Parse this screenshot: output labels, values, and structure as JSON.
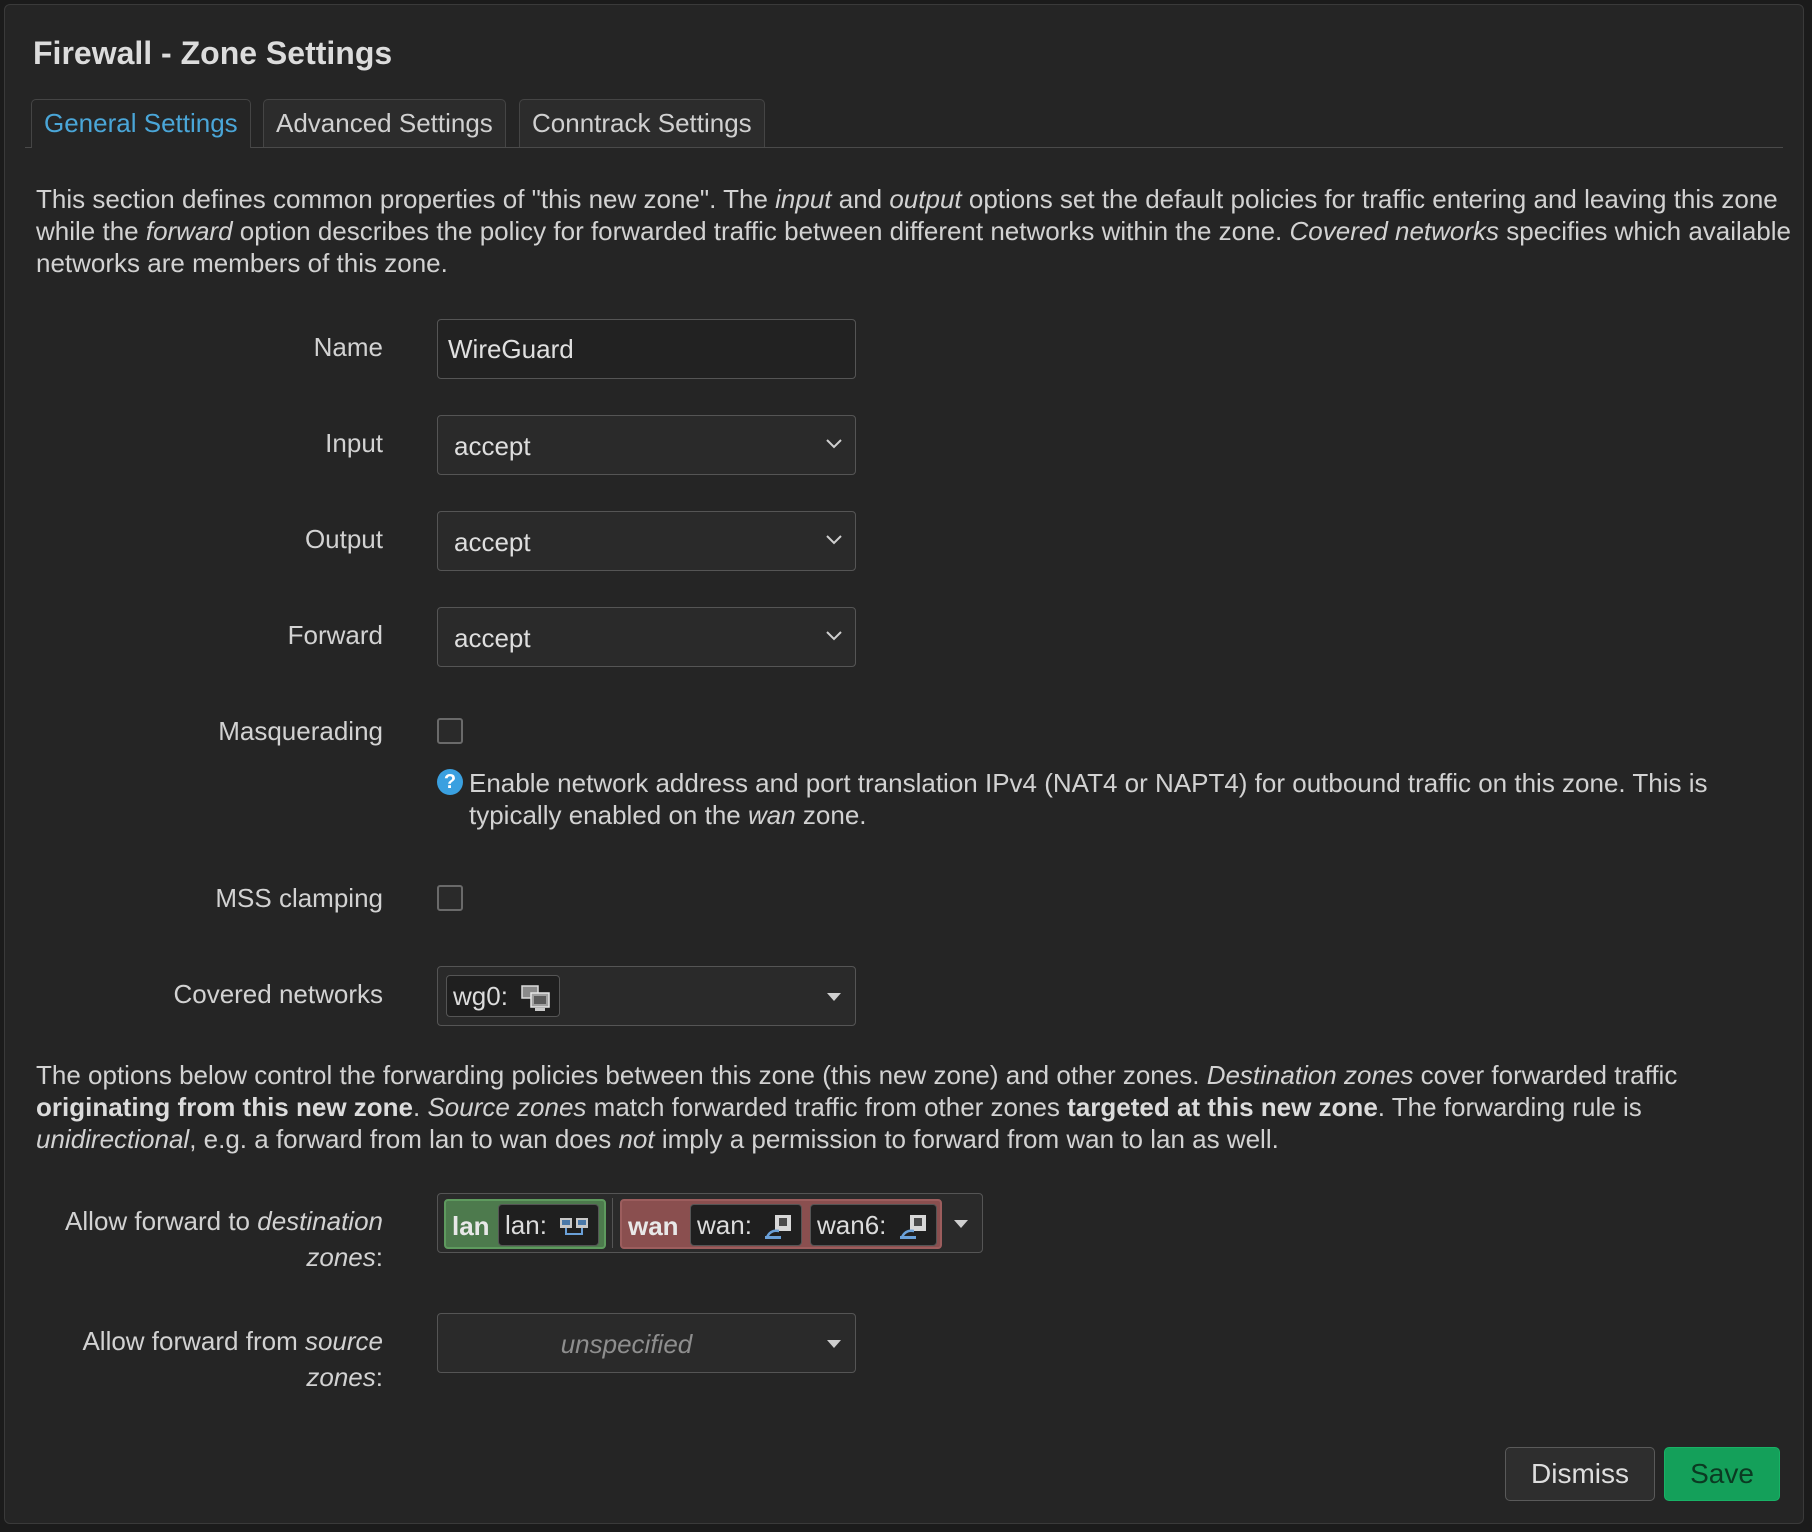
{
  "modal": {
    "title": "Firewall - Zone Settings",
    "tabs": [
      {
        "label": "General Settings",
        "active": true
      },
      {
        "label": "Advanced Settings",
        "active": false
      },
      {
        "label": "Conntrack Settings",
        "active": false
      }
    ],
    "intro": {
      "p1": "This section defines common properties of \"this new zone\". The ",
      "input": "input",
      "p2": " and ",
      "output": "output",
      "p3": " options set the default policies for traffic entering and leaving this zone while the ",
      "forward": "forward",
      "p4": " option describes the policy for forwarded traffic between different networks within the zone. ",
      "covered": "Covered networks",
      "p5": " specifies which available networks are members of this zone."
    },
    "fields": {
      "name_label": "Name",
      "name_value": "WireGuard",
      "input_label": "Input",
      "input_value": "accept",
      "output_label": "Output",
      "output_value": "accept",
      "forward_label": "Forward",
      "forward_value": "accept",
      "masq_label": "Masquerading",
      "masq_checked": false,
      "masq_help": {
        "icon": "?",
        "p1": "Enable network address and port translation IPv4 (NAT4 or NAPT4) for outbound traffic on this zone. This is typically enabled on the ",
        "wan": "wan",
        "p2": " zone."
      },
      "mss_label": "MSS clamping",
      "mss_checked": false,
      "covered_label": "Covered networks",
      "covered_chip": "wg0:"
    },
    "forwarding": {
      "p1": "The options below control the forwarding policies between this zone (this new zone) and other zones. ",
      "dest": "Destination zones",
      "p2": " cover forwarded traffic ",
      "orig": "originating from this new zone",
      "p3": ". ",
      "src": "Source zones",
      "p4": " match forwarded traffic from other zones ",
      "target": "targeted at this new zone",
      "p5": ". The forwarding rule is ",
      "unidir": "unidirectional",
      "p6": ", e.g. a forward from lan to wan does ",
      "not": "not",
      "p7": " imply a permission to forward from wan to lan as well.",
      "dest_label_1": "Allow forward to ",
      "dest_label_em": "destination",
      "dest_label_2": "zones",
      "dest_label_colon": ":",
      "dest_zones": [
        {
          "name": "lan",
          "color": "#4d7a4d",
          "networks": [
            "lan:"
          ]
        },
        {
          "name": "wan",
          "color": "#8a4f4f",
          "networks": [
            "wan:",
            "wan6:"
          ]
        }
      ],
      "src_label_1": "Allow forward from ",
      "src_label_em": "source",
      "src_label_2": "zones",
      "src_label_colon": ":",
      "src_placeholder": "unspecified"
    },
    "buttons": {
      "dismiss": "Dismiss",
      "save": "Save"
    },
    "colors": {
      "accent": "#4aa6d8",
      "save": "#14a05a",
      "lan_zone": "#4d7a4d",
      "wan_zone": "#8a4f4f"
    }
  }
}
